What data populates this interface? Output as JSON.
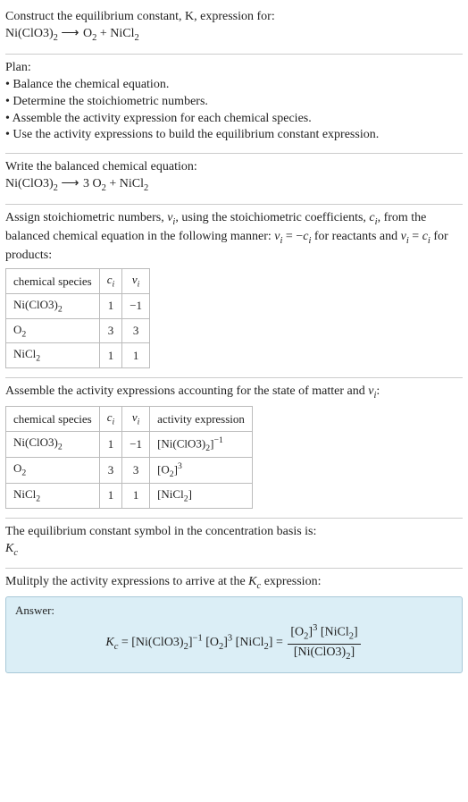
{
  "header": {
    "prompt_line": "Construct the equilibrium constant, K, expression for:",
    "equation_html": "Ni(ClO3)<span class='sub'>2</span> <span class='arrow'>⟶</span> O<span class='sub'>2</span> + NiCl<span class='sub'>2</span>"
  },
  "plan": {
    "title": "Plan:",
    "items": [
      "• Balance the chemical equation.",
      "• Determine the stoichiometric numbers.",
      "• Assemble the activity expression for each chemical species.",
      "• Use the activity expressions to build the equilibrium constant expression."
    ]
  },
  "balanced": {
    "intro": "Write the balanced chemical equation:",
    "equation_html": "Ni(ClO3)<span class='sub'>2</span> <span class='arrow'>⟶</span> 3 O<span class='sub'>2</span> + NiCl<span class='sub'>2</span>"
  },
  "stoich": {
    "intro_html": "Assign stoichiometric numbers, <span class='ital'>ν<span class='sub'>i</span></span>, using the stoichiometric coefficients, <span class='ital'>c<span class='sub'>i</span></span>, from the balanced chemical equation in the following manner: <span class='ital'>ν<span class='sub'>i</span></span> = −<span class='ital'>c<span class='sub'>i</span></span> for reactants and <span class='ital'>ν<span class='sub'>i</span></span> = <span class='ital'>c<span class='sub'>i</span></span> for products:",
    "headers": {
      "species": "chemical species",
      "ci_html": "<span class='ital'>c<span class='sub'>i</span></span>",
      "vi_html": "<span class='ital'>ν<span class='sub'>i</span></span>"
    },
    "rows": [
      {
        "species_html": "Ni(ClO3)<span class='sub'>2</span>",
        "ci": "1",
        "vi": "−1"
      },
      {
        "species_html": "O<span class='sub'>2</span>",
        "ci": "3",
        "vi": "3"
      },
      {
        "species_html": "NiCl<span class='sub'>2</span>",
        "ci": "1",
        "vi": "1"
      }
    ]
  },
  "activity": {
    "intro_html": "Assemble the activity expressions accounting for the state of matter and <span class='ital'>ν<span class='sub'>i</span></span>:",
    "headers": {
      "species": "chemical species",
      "ci_html": "<span class='ital'>c<span class='sub'>i</span></span>",
      "vi_html": "<span class='ital'>ν<span class='sub'>i</span></span>",
      "activity": "activity expression"
    },
    "rows": [
      {
        "species_html": "Ni(ClO3)<span class='sub'>2</span>",
        "ci": "1",
        "vi": "−1",
        "act_html": "[Ni(ClO3)<span class='sub'>2</span>]<span class='sup'>−1</span>"
      },
      {
        "species_html": "O<span class='sub'>2</span>",
        "ci": "3",
        "vi": "3",
        "act_html": "[O<span class='sub'>2</span>]<span class='sup'>3</span>"
      },
      {
        "species_html": "NiCl<span class='sub'>2</span>",
        "ci": "1",
        "vi": "1",
        "act_html": "[NiCl<span class='sub'>2</span>]"
      }
    ]
  },
  "symbol": {
    "intro": "The equilibrium constant symbol in the concentration basis is:",
    "symbol_html": "<span class='ital'>K<span class='sub'>c</span></span>"
  },
  "final": {
    "intro_html": "Mulitply the activity expressions to arrive at the <span class='ital'>K<span class='sub'>c</span></span> expression:",
    "answer_label": "Answer:",
    "expr_left_html": "<span class='ital'>K<span class='sub'>c</span></span> = [Ni(ClO3)<span class='sub'>2</span>]<span class='sup'>−1</span> [O<span class='sub'>2</span>]<span class='sup'>3</span> [NiCl<span class='sub'>2</span>] = ",
    "frac_num_html": "[O<span class='sub'>2</span>]<span class='sup'>3</span> [NiCl<span class='sub'>2</span>]",
    "frac_den_html": "[Ni(ClO3)<span class='sub'>2</span>]"
  }
}
